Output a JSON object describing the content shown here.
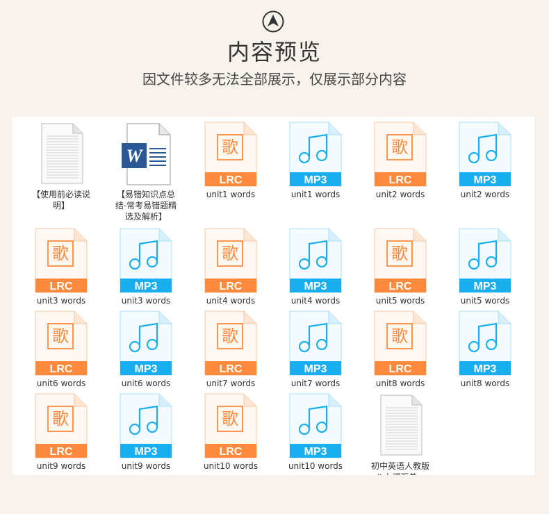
{
  "header": {
    "title": "内容预览",
    "subtitle": "因文件较多无法全部展示，仅展示部分内容"
  },
  "colors": {
    "lrc_orange": "#ff8a3d",
    "mp3_blue": "#18aef0",
    "background": "#f7f3ec"
  },
  "files": [
    {
      "type": "doc",
      "label": "【使用前必读说\n明】"
    },
    {
      "type": "word",
      "label": "【易错知识点总\n结-常考易错题精\n选及解析】"
    },
    {
      "type": "lrc",
      "label": "unit1 words",
      "badge": "LRC",
      "glyph": "歌"
    },
    {
      "type": "mp3",
      "label": "unit1 words",
      "badge": "MP3"
    },
    {
      "type": "lrc",
      "label": "unit2 words",
      "badge": "LRC",
      "glyph": "歌"
    },
    {
      "type": "mp3",
      "label": "unit2 words",
      "badge": "MP3"
    },
    {
      "type": "lrc",
      "label": "unit3 words",
      "badge": "LRC",
      "glyph": "歌"
    },
    {
      "type": "mp3",
      "label": "unit3 words",
      "badge": "MP3"
    },
    {
      "type": "lrc",
      "label": "unit4 words",
      "badge": "LRC",
      "glyph": "歌"
    },
    {
      "type": "mp3",
      "label": "unit4 words",
      "badge": "MP3"
    },
    {
      "type": "lrc",
      "label": "unit5 words",
      "badge": "LRC",
      "glyph": "歌"
    },
    {
      "type": "mp3",
      "label": "unit5 words",
      "badge": "MP3"
    },
    {
      "type": "lrc",
      "label": "unit6 words",
      "badge": "LRC",
      "glyph": "歌"
    },
    {
      "type": "mp3",
      "label": "unit6 words",
      "badge": "MP3"
    },
    {
      "type": "lrc",
      "label": "unit7 words",
      "badge": "LRC",
      "glyph": "歌"
    },
    {
      "type": "mp3",
      "label": "unit7 words",
      "badge": "MP3"
    },
    {
      "type": "lrc",
      "label": "unit8 words",
      "badge": "LRC",
      "glyph": "歌"
    },
    {
      "type": "mp3",
      "label": "unit8 words",
      "badge": "MP3"
    },
    {
      "type": "lrc",
      "label": "unit9 words",
      "badge": "LRC",
      "glyph": "歌"
    },
    {
      "type": "mp3",
      "label": "unit9 words",
      "badge": "MP3"
    },
    {
      "type": "lrc",
      "label": "unit10 words",
      "badge": "LRC",
      "glyph": "歌"
    },
    {
      "type": "mp3",
      "label": "unit10 words",
      "badge": "MP3"
    },
    {
      "type": "doc",
      "label": "初中英语人教版\n八上词汇总..."
    }
  ]
}
